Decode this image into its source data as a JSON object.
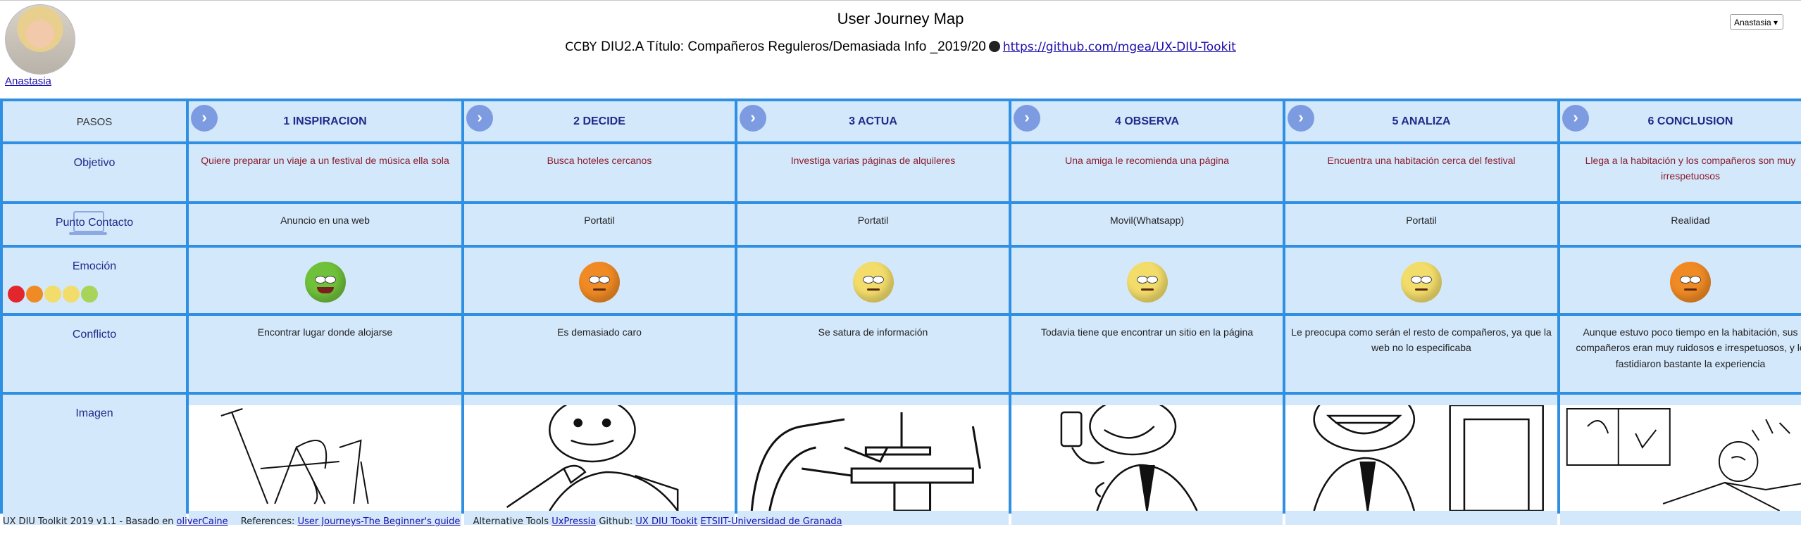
{
  "header": {
    "title": "User Journey Map",
    "cc_label": "CCBY",
    "subtitle": "DIU2.A Título: Compañeros Reguleros/Demasiada Info _2019/20",
    "repo_link": "https://github.com/mgea/UX-DIU-Tookit",
    "user_name": "Anastasia",
    "user_select_value": "Anastasia ▾"
  },
  "row_labels": {
    "steps": "PASOS",
    "goal": "Objetivo",
    "touchpoint": "Punto Contacto",
    "emotion": "Emoción",
    "conflict": "Conflicto",
    "image": "Imagen"
  },
  "steps": [
    {
      "title": "1 INSPIRACION",
      "goal": "Quiere preparar un viaje a un festival de música ella sola",
      "touchpoint": "Anuncio en una web",
      "emotion": "happy",
      "conflict": "Encontrar lugar donde alojarse",
      "image": "man-cleaning-sketch"
    },
    {
      "title": "2 DECIDE",
      "goal": "Busca hoteles cercanos",
      "touchpoint": "Portatil",
      "emotion": "upset",
      "conflict": "Es demasiado caro",
      "image": "man-thinking-pen-sketch"
    },
    {
      "title": "3 ACTUA",
      "goal": "Investiga varias páginas de alquileres",
      "touchpoint": "Portatil",
      "emotion": "neutral",
      "conflict": "Se satura de información",
      "image": "desk-computer-sketch"
    },
    {
      "title": "4 OBSERVA",
      "goal": "Una amiga le recomienda una página",
      "touchpoint": "Movil(Whatsapp)",
      "emotion": "neutral",
      "conflict": "Todavia tiene que encontrar un sitio en la página",
      "image": "man-phone-sketch"
    },
    {
      "title": "5 ANALIZA",
      "goal": "Encuentra una habitación cerca del festival",
      "touchpoint": "Portatil",
      "emotion": "neutral",
      "conflict": "Le preocupa como serán el resto de compañeros, ya que la web no lo especificaba",
      "image": "man-smiling-computer-sketch"
    },
    {
      "title": "6 CONCLUSION",
      "goal": "Llega a la habitación y los compañeros son muy irrespetuosos",
      "touchpoint": "Realidad",
      "emotion": "upset",
      "conflict": "Aunque estuvo poco tiempo en la habitación, sus compañeros eran muy ruidosos e irrespetuosos, y le fastidiaron bastante la experiencia",
      "image": "man-bed-noise-sketch"
    }
  ],
  "emotion_colors": {
    "happy": "#6fc13a",
    "upset": "#f08a24",
    "neutral": "#f2dc6a",
    "angry": "#e2262c",
    "ok": "#a8d45a"
  },
  "footer": {
    "prefix": "UX DIU Toolkit 2019 v1.1 - Basado en",
    "link1": "oliverCaine",
    "refs_label": "References:",
    "link2": "User Journeys-The Beginner's guide",
    "alt_label": "Alternative Tools",
    "link3": "UxPressia",
    "github_label": "Github:",
    "link4": "UX DIU Tookit",
    "link5": "ETSIIT-Universidad de Granada"
  }
}
